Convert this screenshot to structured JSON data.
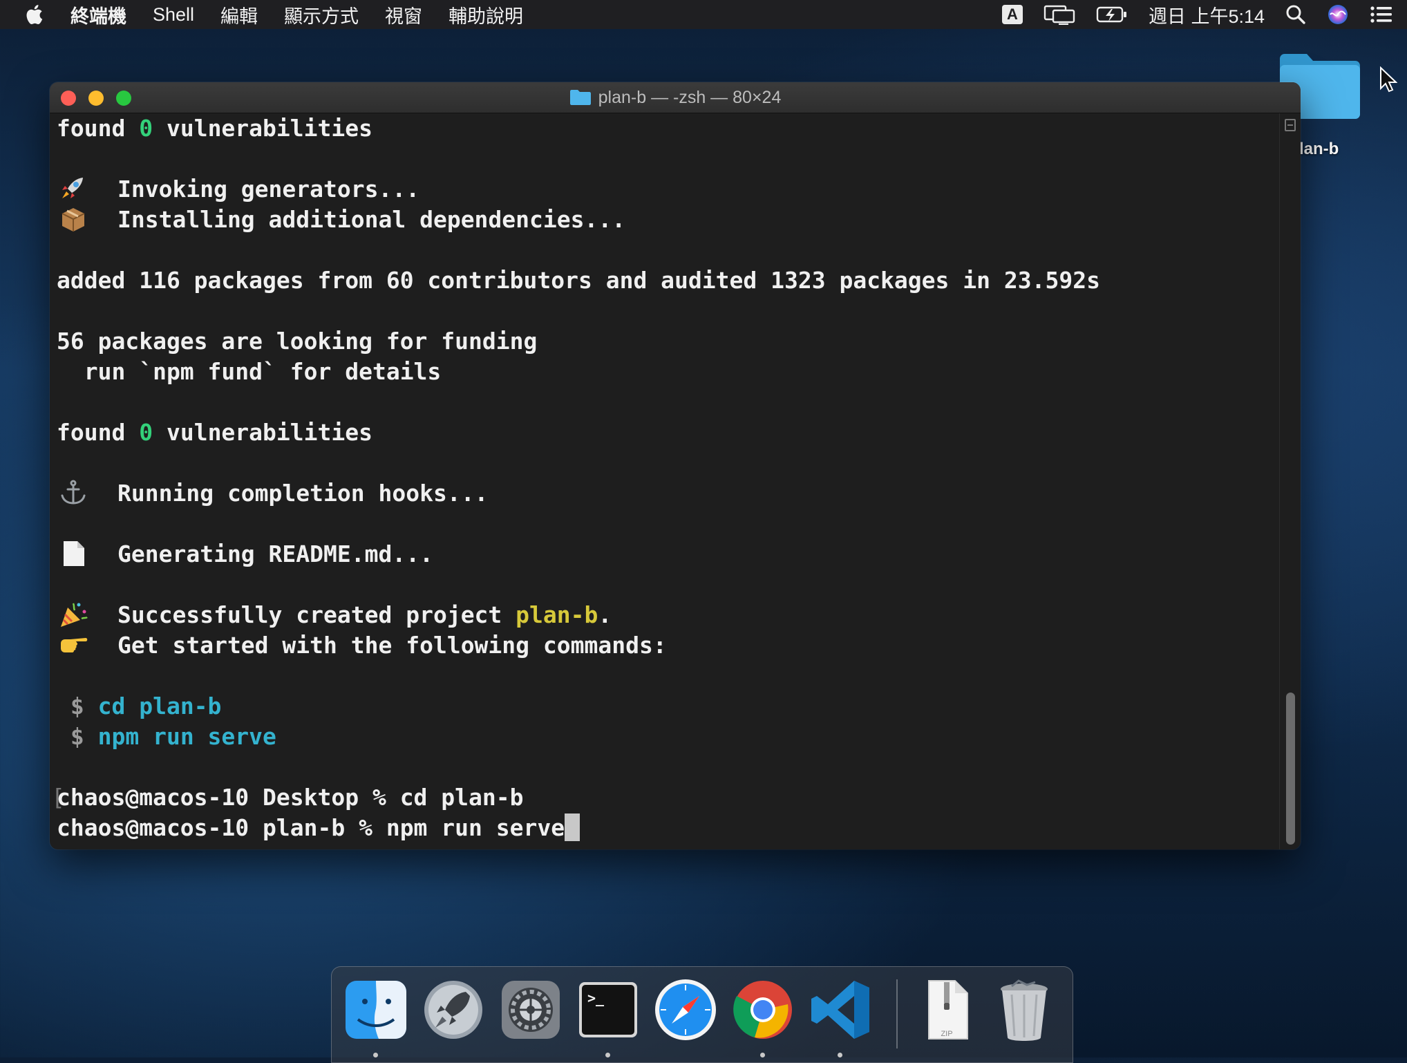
{
  "menubar": {
    "apple_icon": "apple-icon",
    "items": [
      "終端機",
      "Shell",
      "編輯",
      "顯示方式",
      "視窗",
      "輔助說明"
    ],
    "input_source": "A",
    "clock": "週日 上午5:14",
    "status_icons": [
      "display-mirroring-icon",
      "battery-charging-icon",
      "spotlight-search-icon",
      "siri-icon",
      "notification-center-icon"
    ]
  },
  "desktop": {
    "folder_label": "lan-b",
    "folder_color": "#3ba7e0"
  },
  "terminal": {
    "title": "plan-b — -zsh — 80×24",
    "lines": {
      "l1": {
        "pre": "found ",
        "num": "0",
        "post": " vulnerabilities"
      },
      "l3": "Invoking generators...",
      "l4": "Installing additional dependencies...",
      "l6": "added 116 packages from 60 contributors and audited 1323 packages in 23.592s",
      "l8": "56 packages are looking for funding",
      "l9": "  run `npm fund` for details",
      "l11": {
        "pre": "found ",
        "num": "0",
        "post": " vulnerabilities"
      },
      "l13": "Running completion hooks...",
      "l15": "Generating README.md...",
      "l17": {
        "pre": "Successfully created project ",
        "project": "plan-b",
        "post": "."
      },
      "l18": "Get started with the following commands:",
      "l20": {
        "prompt": " $ ",
        "cmd": "cd plan-b"
      },
      "l21": {
        "prompt": " $ ",
        "cmd": "npm run serve"
      },
      "l23": "chaos@macos-10 Desktop % cd plan-b",
      "l24": "chaos@macos-10 plan-b % npm run serve"
    },
    "emoji_icons": [
      "rocket-icon",
      "package-icon",
      "anchor-icon",
      "document-icon",
      "party-popper-icon",
      "pointing-hand-icon"
    ],
    "colors": {
      "green": "#33d17a",
      "yellow": "#d7c93a",
      "cyan": "#34b3cf",
      "background": "#1e1e1e"
    }
  },
  "dock": {
    "apps": [
      "finder-icon",
      "launchpad-icon",
      "system-preferences-icon",
      "terminal-icon",
      "safari-icon",
      "chrome-icon",
      "vscode-icon",
      "zip-archive-icon",
      "trash-icon"
    ],
    "terminal_icon_text": ">_",
    "zip_label": "ZIP"
  }
}
